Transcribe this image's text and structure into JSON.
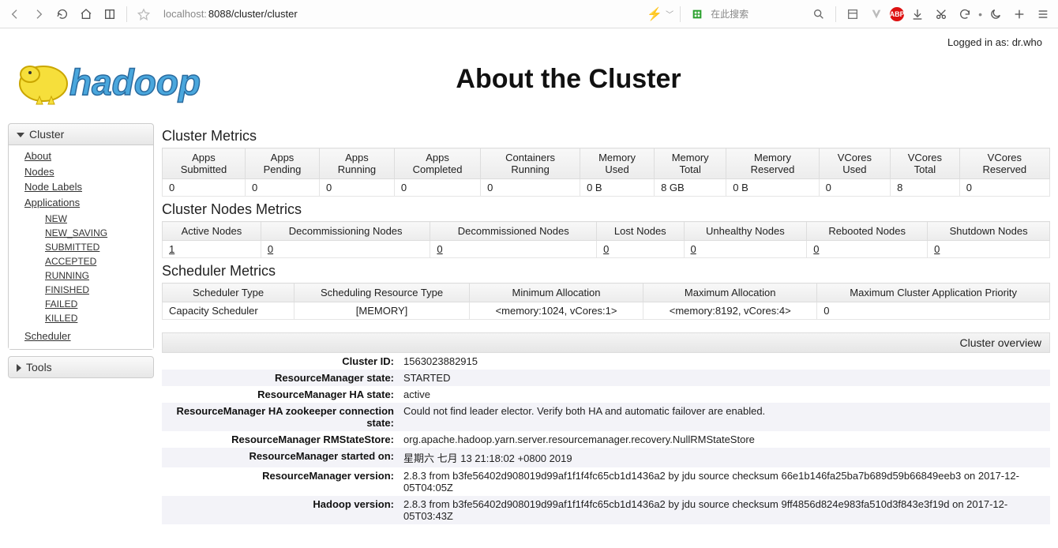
{
  "browser": {
    "url_host": "localhost:",
    "url_path": "8088/cluster/cluster",
    "search_placeholder": "在此搜索",
    "abp_label": "ABP"
  },
  "loginbar": {
    "prefix": "Logged in as: ",
    "user": "dr.who"
  },
  "title": "About the Cluster",
  "sidebar": {
    "cluster_label": "Cluster",
    "tools_label": "Tools",
    "items": {
      "about": "About",
      "nodes": "Nodes",
      "nodelabels": "Node Labels",
      "applications": "Applications",
      "scheduler": "Scheduler"
    },
    "appstates": {
      "new": "NEW",
      "newsaving": "NEW_SAVING",
      "submitted": "SUBMITTED",
      "accepted": "ACCEPTED",
      "running": "RUNNING",
      "finished": "FINISHED",
      "failed": "FAILED",
      "killed": "KILLED"
    }
  },
  "sections": {
    "cluster_metrics": "Cluster Metrics",
    "cluster_nodes": "Cluster Nodes Metrics",
    "scheduler": "Scheduler Metrics",
    "overview": "Cluster overview"
  },
  "cluster_metrics": {
    "headers": {
      "apps_sub": "Apps Submitted",
      "apps_pend": "Apps Pending",
      "apps_run": "Apps Running",
      "apps_comp": "Apps Completed",
      "cont_run": "Containers Running",
      "mem_used": "Memory Used",
      "mem_total": "Memory Total",
      "mem_res": "Memory Reserved",
      "vc_used": "VCores Used",
      "vc_total": "VCores Total",
      "vc_res": "VCores Reserved"
    },
    "values": {
      "apps_sub": "0",
      "apps_pend": "0",
      "apps_run": "0",
      "apps_comp": "0",
      "cont_run": "0",
      "mem_used": "0 B",
      "mem_total": "8 GB",
      "mem_res": "0 B",
      "vc_used": "0",
      "vc_total": "8",
      "vc_res": "0"
    }
  },
  "cluster_nodes": {
    "headers": {
      "active": "Active Nodes",
      "decomming": "Decommissioning Nodes",
      "decommed": "Decommissioned Nodes",
      "lost": "Lost Nodes",
      "unhealthy": "Unhealthy Nodes",
      "reboot": "Rebooted Nodes",
      "shutdown": "Shutdown Nodes"
    },
    "values": {
      "active": "1",
      "decomming": "0",
      "decommed": "0",
      "lost": "0",
      "unhealthy": "0",
      "reboot": "0",
      "shutdown": "0"
    }
  },
  "scheduler_metrics": {
    "headers": {
      "type": "Scheduler Type",
      "res_type": "Scheduling Resource Type",
      "min": "Minimum Allocation",
      "max": "Maximum Allocation",
      "prio": "Maximum Cluster Application Priority"
    },
    "values": {
      "type": "Capacity Scheduler",
      "res_type": "[MEMORY]",
      "min": "<memory:1024, vCores:1>",
      "max": "<memory:8192, vCores:4>",
      "prio": "0"
    }
  },
  "overview": {
    "cluster_id": {
      "k": "Cluster ID:",
      "v": "1563023882915"
    },
    "rm_state": {
      "k": "ResourceManager state:",
      "v": "STARTED"
    },
    "rm_ha_state": {
      "k": "ResourceManager HA state:",
      "v": "active"
    },
    "rm_ha_zk": {
      "k": "ResourceManager HA zookeeper connection state:",
      "v": "Could not find leader elector. Verify both HA and automatic failover are enabled."
    },
    "rm_statestore": {
      "k": "ResourceManager RMStateStore:",
      "v": "org.apache.hadoop.yarn.server.resourcemanager.recovery.NullRMStateStore"
    },
    "rm_started": {
      "k": "ResourceManager started on:",
      "v": "星期六 七月 13 21:18:02 +0800 2019"
    },
    "rm_version": {
      "k": "ResourceManager version:",
      "v": "2.8.3 from b3fe56402d908019d99af1f1f4fc65cb1d1436a2 by jdu source checksum 66e1b146fa25ba7b689d59b66849eeb3 on 2017-12-05T04:05Z"
    },
    "hadoop_version": {
      "k": "Hadoop version:",
      "v": "2.8.3 from b3fe56402d908019d99af1f1f4fc65cb1d1436a2 by jdu source checksum 9ff4856d824e983fa510d3f843e3f19d on 2017-12-05T03:43Z"
    }
  }
}
